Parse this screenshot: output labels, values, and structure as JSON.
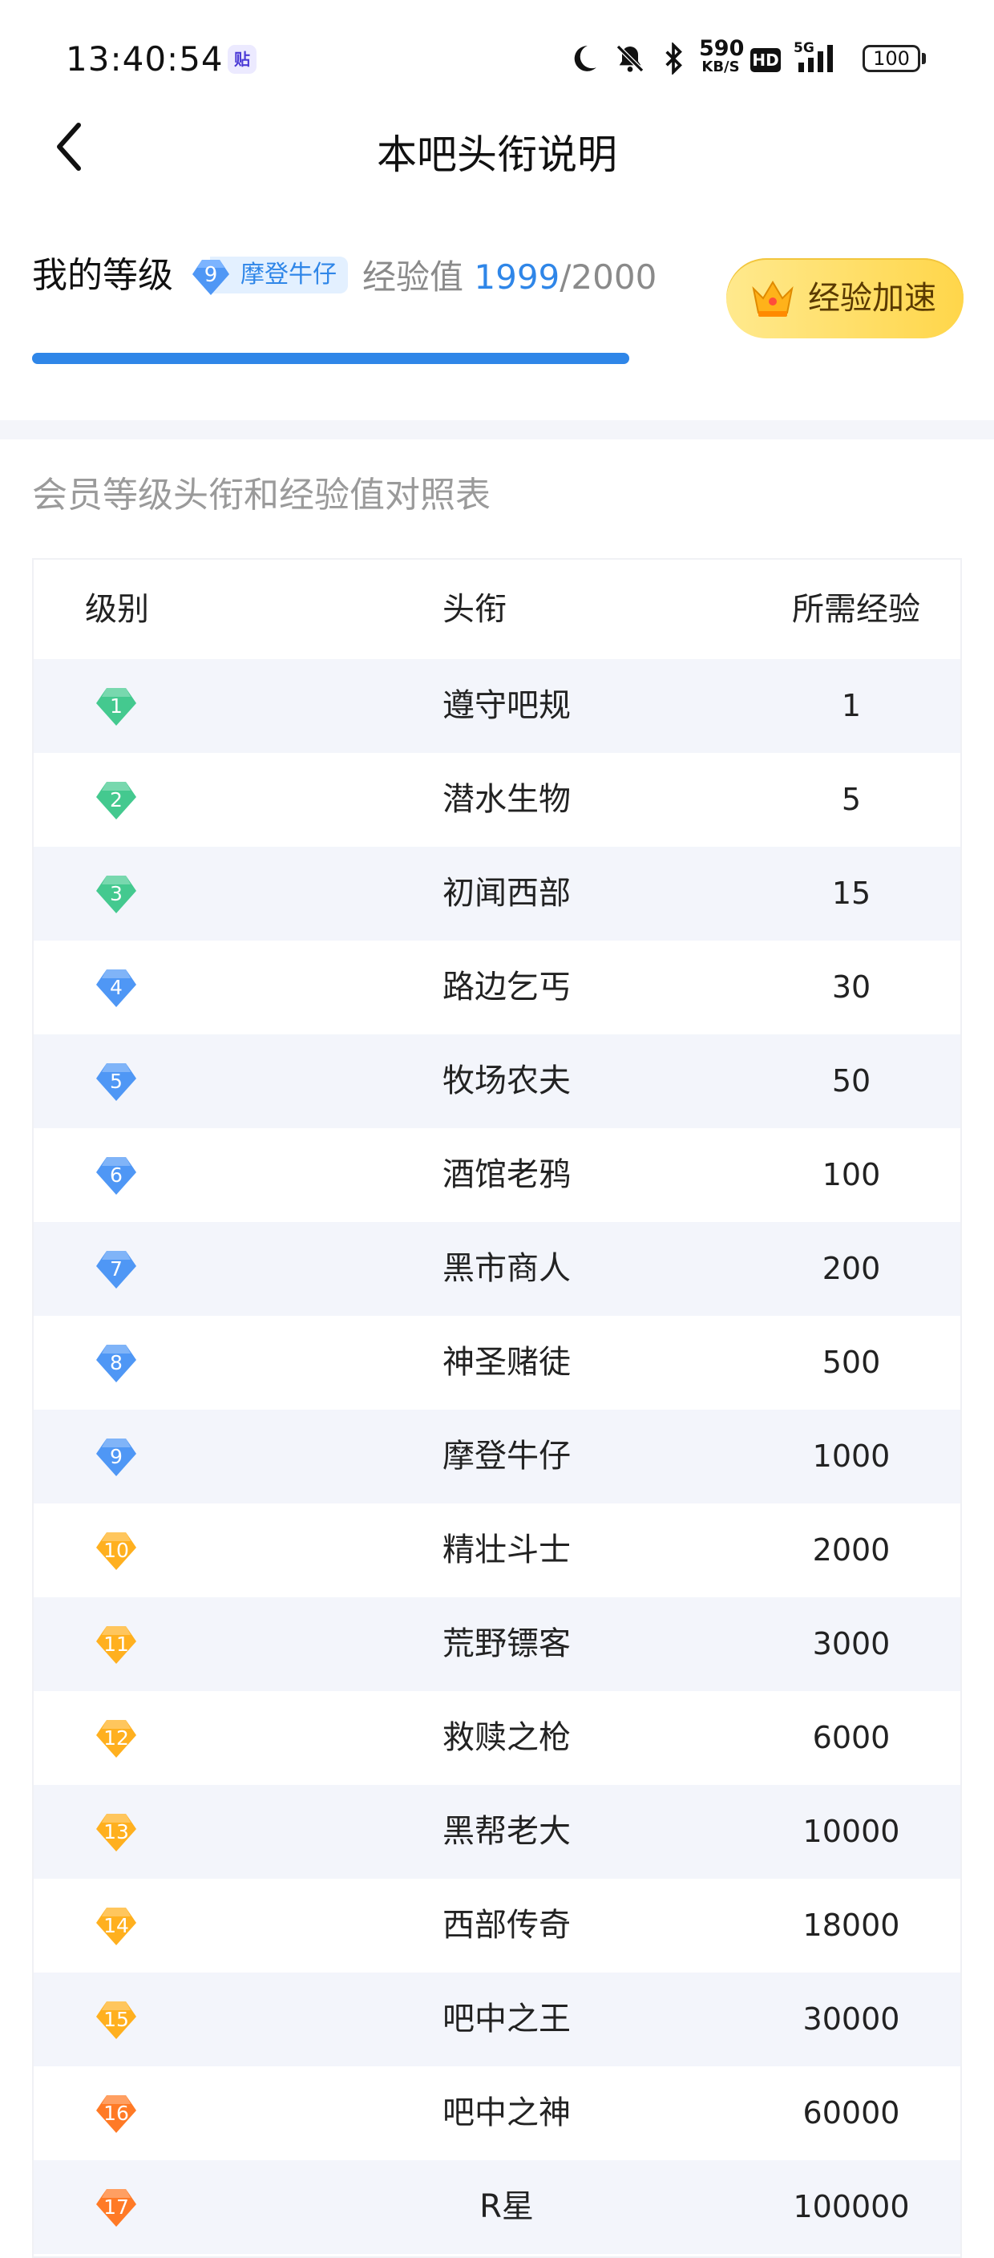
{
  "status_bar": {
    "time": "13:40:54",
    "app_badge": "贴",
    "net_speed_value": "590",
    "net_speed_unit": "KB/S",
    "hd": "HD",
    "signal_type": "5G",
    "battery": "100",
    "icons": [
      "moon-icon",
      "bell-off-icon",
      "bluetooth-icon",
      "signal-icon"
    ]
  },
  "nav": {
    "title": "本吧头衔说明",
    "back_icon": "chevron-left-icon"
  },
  "my_level": {
    "label": "我的等级",
    "level": "9",
    "level_title": "摩登牛仔",
    "exp_label": "经验值",
    "exp_current": "1999",
    "exp_sep_total": "/2000",
    "progress": 0.9995,
    "boost_button": "经验加速"
  },
  "table": {
    "section_title": "会员等级头衔和经验值对照表",
    "headers": [
      "级别",
      "头衔",
      "所需经验"
    ],
    "rows": [
      {
        "level": "1",
        "title": "遵守吧规",
        "exp": "1",
        "color": "#44c98f"
      },
      {
        "level": "2",
        "title": "潜水生物",
        "exp": "5",
        "color": "#44c98f"
      },
      {
        "level": "3",
        "title": "初闻西部",
        "exp": "15",
        "color": "#44c98f"
      },
      {
        "level": "4",
        "title": "路边乞丐",
        "exp": "30",
        "color": "#4f97f5"
      },
      {
        "level": "5",
        "title": "牧场农夫",
        "exp": "50",
        "color": "#4f97f5"
      },
      {
        "level": "6",
        "title": "酒馆老鸦",
        "exp": "100",
        "color": "#4f97f5"
      },
      {
        "level": "7",
        "title": "黑市商人",
        "exp": "200",
        "color": "#4f97f5"
      },
      {
        "level": "8",
        "title": "神圣赌徒",
        "exp": "500",
        "color": "#4f97f5"
      },
      {
        "level": "9",
        "title": "摩登牛仔",
        "exp": "1000",
        "color": "#4f97f5"
      },
      {
        "level": "10",
        "title": "精壮斗士",
        "exp": "2000",
        "color": "#ffb01f"
      },
      {
        "level": "11",
        "title": "荒野镖客",
        "exp": "3000",
        "color": "#ffb01f"
      },
      {
        "level": "12",
        "title": "救赎之枪",
        "exp": "6000",
        "color": "#ffb01f"
      },
      {
        "level": "13",
        "title": "黑帮老大",
        "exp": "10000",
        "color": "#ffb01f"
      },
      {
        "level": "14",
        "title": "西部传奇",
        "exp": "18000",
        "color": "#ffb01f"
      },
      {
        "level": "15",
        "title": "吧中之王",
        "exp": "30000",
        "color": "#ffb01f"
      },
      {
        "level": "16",
        "title": "吧中之神",
        "exp": "60000",
        "color": "#ff7a26"
      },
      {
        "level": "17",
        "title": "R星",
        "exp": "100000",
        "color": "#ff7a26"
      }
    ]
  }
}
